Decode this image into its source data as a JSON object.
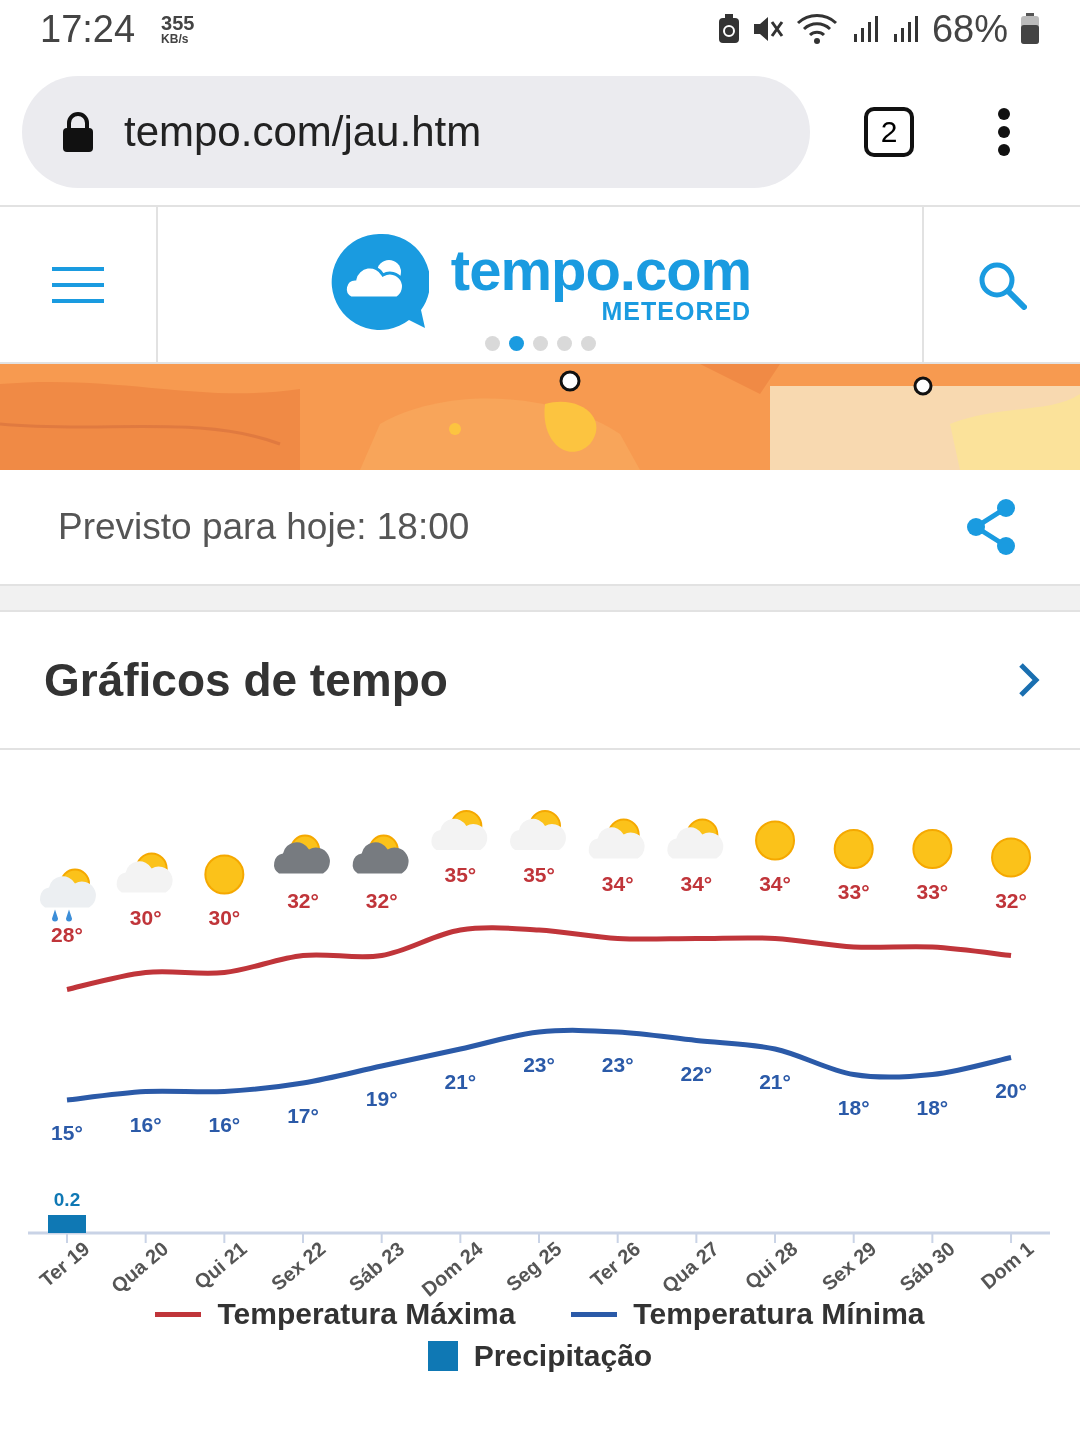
{
  "status_bar": {
    "time": "17:24",
    "speed": "355",
    "speed_unit": "KB/s",
    "battery": "68%"
  },
  "browser": {
    "url": "tempo.com/jau.htm",
    "tab_count": "2"
  },
  "header": {
    "logo_name": "tempo.com",
    "logo_sub": "METEORED",
    "carousel_dots": [
      {
        "selected": false
      },
      {
        "selected": true
      },
      {
        "selected": false
      },
      {
        "selected": false
      },
      {
        "selected": false
      }
    ]
  },
  "forecast_time": "Previsto para hoje: 18:00",
  "section": {
    "title": "Gráficos de tempo"
  },
  "weather_icons": [
    {
      "kind": "rain"
    },
    {
      "kind": "sun-cloud"
    },
    {
      "kind": "sun"
    },
    {
      "kind": "grey-cloud"
    },
    {
      "kind": "grey-cloud"
    },
    {
      "kind": "sun-cloud"
    },
    {
      "kind": "sun-cloud"
    },
    {
      "kind": "sun-cloud"
    },
    {
      "kind": "sun-cloud"
    },
    {
      "kind": "sun"
    },
    {
      "kind": "sun"
    },
    {
      "kind": "sun"
    },
    {
      "kind": "sun"
    }
  ],
  "chart_data": {
    "type": "line",
    "categories": [
      "Ter 19",
      "Qua 20",
      "Qui 21",
      "Sex 22",
      "Sáb 23",
      "Dom 24",
      "Seg 25",
      "Ter 26",
      "Qua 27",
      "Qui 28",
      "Sex 29",
      "Sáb 30",
      "Dom 1"
    ],
    "series": [
      {
        "name": "Temperatura Máxima",
        "color": "#c0353a",
        "values": [
          28,
          30,
          30,
          32,
          32,
          35,
          35,
          34,
          34,
          34,
          33,
          33,
          32
        ],
        "value_labels": [
          "28°",
          "30°",
          "30°",
          "32°",
          "32°",
          "35°",
          "35°",
          "34°",
          "34°",
          "34°",
          "33°",
          "33°",
          "32°"
        ]
      },
      {
        "name": "Temperatura Mínima",
        "color": "#2b5aa8",
        "values": [
          15,
          16,
          16,
          17,
          19,
          21,
          23,
          23,
          22,
          21,
          18,
          18,
          20
        ],
        "value_labels": [
          "15°",
          "16°",
          "16°",
          "17°",
          "19°",
          "21°",
          "23°",
          "23°",
          "22°",
          "21°",
          "18°",
          "18°",
          "20°"
        ]
      }
    ]
  },
  "precipitation": {
    "name": "Precipitação",
    "color": "#0f78b4",
    "first_day_value": "0.2"
  }
}
